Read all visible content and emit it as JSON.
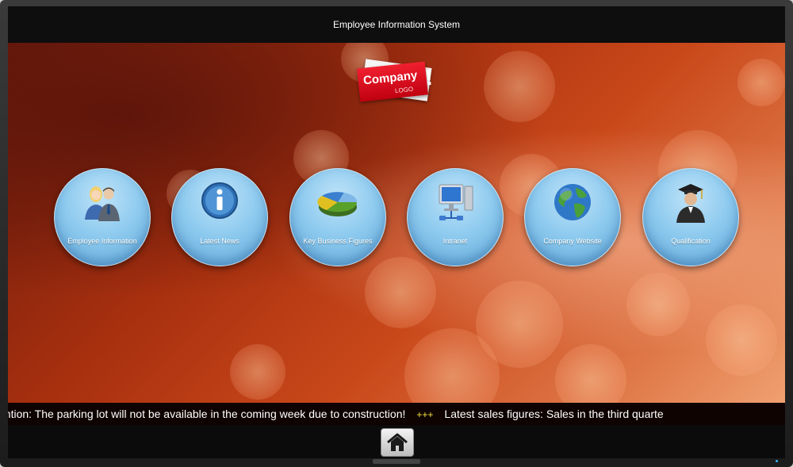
{
  "window": {
    "title": "Employee Information System"
  },
  "logo": {
    "company": "Company",
    "sub": "LOGO",
    "exclaim": "!"
  },
  "tiles": [
    {
      "label": "Employee Information",
      "icon": "people-icon"
    },
    {
      "label": "Latest News",
      "icon": "info-icon"
    },
    {
      "label": "Key Business Figures",
      "icon": "pie-chart-icon"
    },
    {
      "label": "Intranet",
      "icon": "computer-network-icon"
    },
    {
      "label": "Company Website",
      "icon": "globe-icon"
    },
    {
      "label": "Qualification",
      "icon": "graduate-icon"
    }
  ],
  "ticker": {
    "messages": [
      "ention: The parking lot will not be available in the coming week due to construction!",
      "Latest sales figures: Sales in the third quarte"
    ],
    "separator": "+++"
  },
  "home": {
    "icon": "home-icon"
  },
  "colors": {
    "tile_blue": "#8fcbef",
    "ticker_separator": "#f7e040",
    "logo_red": "#e01020"
  }
}
